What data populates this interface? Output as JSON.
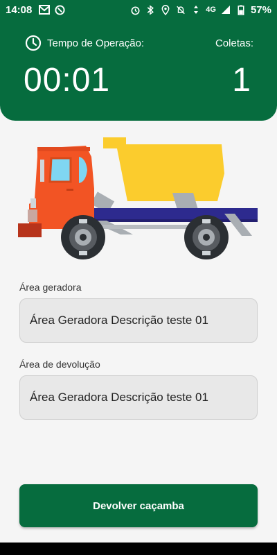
{
  "status_bar": {
    "time": "14:08",
    "network": "4G",
    "battery": "57%"
  },
  "header": {
    "timer_label": "Tempo de Operação:",
    "timer_value": "00:01",
    "collections_label": "Coletas:",
    "collections_value": "1"
  },
  "illustration": {
    "icon": "dump-truck-illustration"
  },
  "fields": [
    {
      "label": "Área geradora",
      "value": "Área Geradora Descrição teste 01"
    },
    {
      "label": "Área de devolução",
      "value": "Área Geradora Descrição teste 01"
    }
  ],
  "action": {
    "label": "Devolver caçamba"
  },
  "colors": {
    "primary": "#066c3e",
    "background": "#f5f5f5",
    "field_background": "#e8e8e8"
  }
}
